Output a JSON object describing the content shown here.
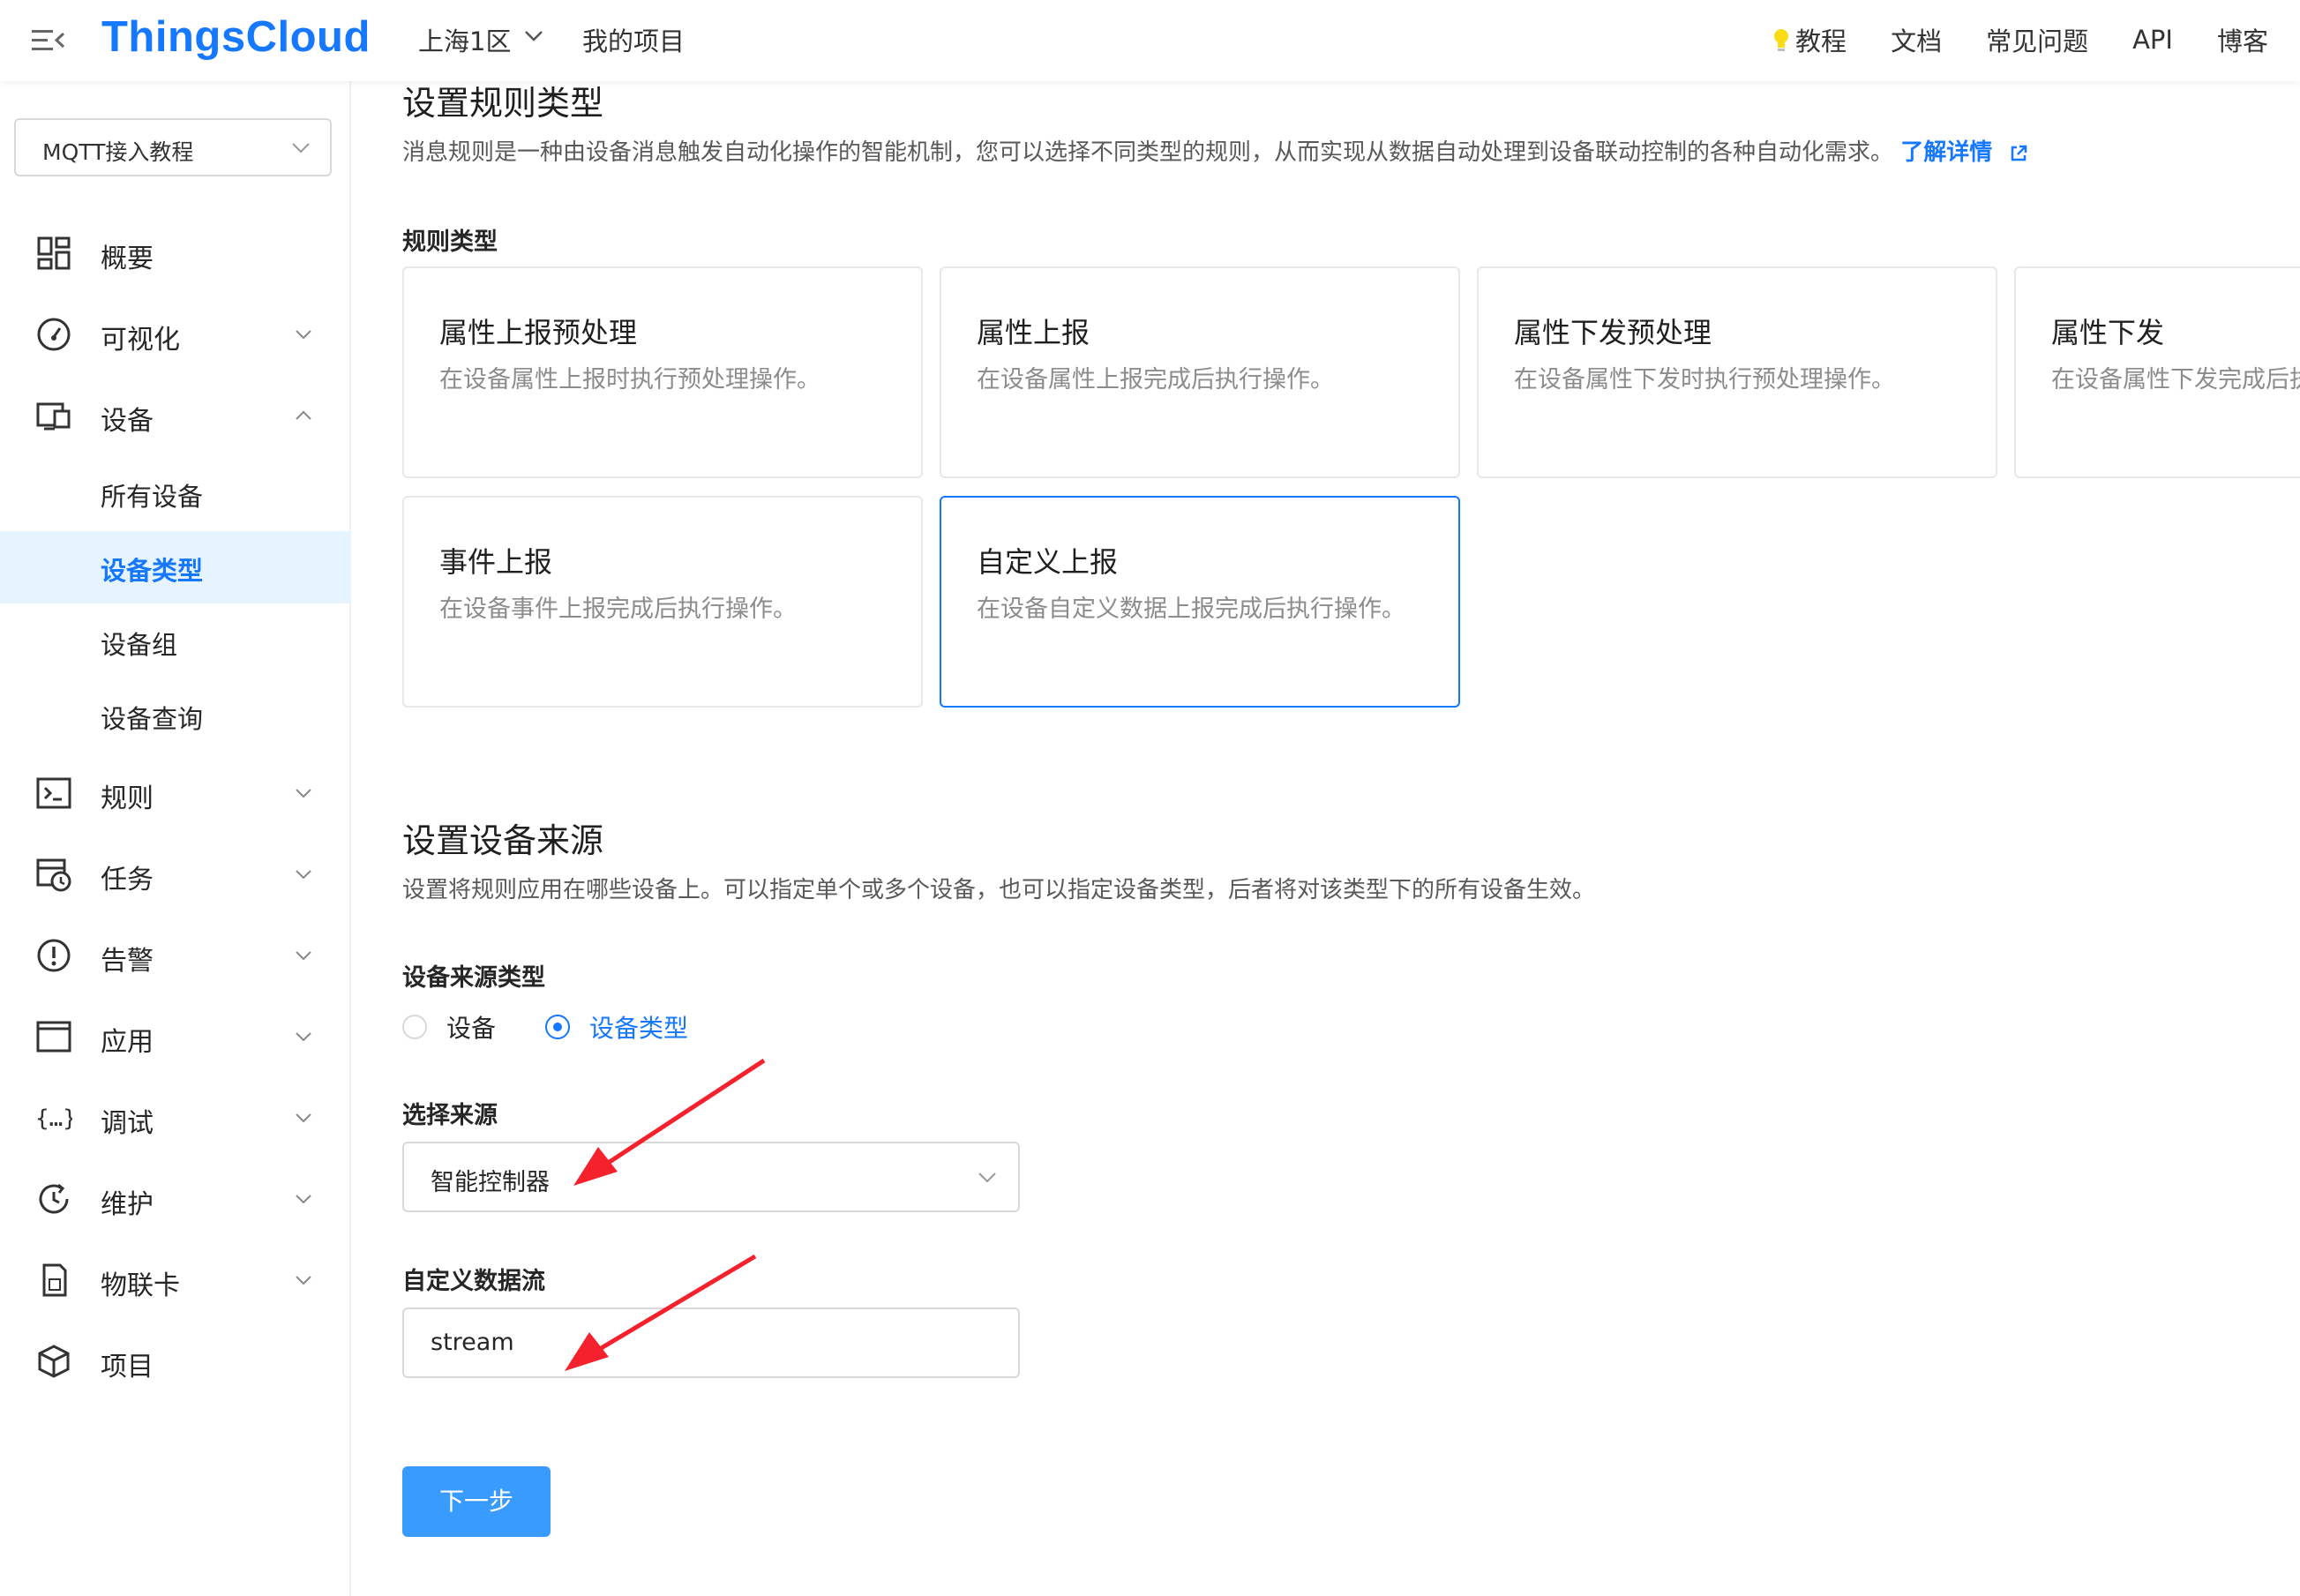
{
  "topbar": {
    "logo": "ThingsCloud",
    "region": "上海1区",
    "my_projects": "我的项目",
    "links": {
      "tutorial": "教程",
      "docs": "文档",
      "faq": "常见问题",
      "api": "API",
      "blog": "博客"
    }
  },
  "sidebar": {
    "project": "MQTT接入教程",
    "items": {
      "overview": "概要",
      "visual": "可视化",
      "device": "设备",
      "all_devices": "所有设备",
      "device_types": "设备类型",
      "device_groups": "设备组",
      "device_query": "设备查询",
      "rules": "规则",
      "tasks": "任务",
      "alarms": "告警",
      "apps": "应用",
      "debug": "调试",
      "maintain": "维护",
      "iot_card": "物联卡",
      "project": "项目"
    }
  },
  "rule_type_section": {
    "title": "设置规则类型",
    "desc": "消息规则是一种由设备消息触发自动化操作的智能机制，您可以选择不同类型的规则，从而实现从数据自动处理到设备联动控制的各种自动化需求。",
    "learn_more": "了解详情",
    "label": "规则类型",
    "cards": [
      {
        "title": "属性上报预处理",
        "desc": "在设备属性上报时执行预处理操作。"
      },
      {
        "title": "属性上报",
        "desc": "在设备属性上报完成后执行操作。"
      },
      {
        "title": "属性下发预处理",
        "desc": "在设备属性下发时执行预处理操作。"
      },
      {
        "title": "属性下发",
        "desc": "在设备属性下发完成后执行操作。"
      },
      {
        "title": "事件上报",
        "desc": "在设备事件上报完成后执行操作。"
      },
      {
        "title": "自定义上报",
        "desc": "在设备自定义数据上报完成后执行操作。"
      }
    ],
    "selected_card": "自定义上报"
  },
  "device_source_section": {
    "title": "设置设备来源",
    "desc": "设置将规则应用在哪些设备上。可以指定单个或多个设备，也可以指定设备类型，后者将对该类型下的所有设备生效。",
    "source_type_label": "设备来源类型",
    "radio_device": "设备",
    "radio_device_type": "设备类型",
    "selected_radio": "设备类型",
    "select_source_label": "选择来源",
    "select_source_value": "智能控制器",
    "custom_stream_label": "自定义数据流",
    "custom_stream_value": "stream"
  },
  "next_button": "下一步",
  "colors": {
    "primary": "#1677ff",
    "button": "#3a9bff",
    "annotation_arrow": "#f5222d"
  }
}
